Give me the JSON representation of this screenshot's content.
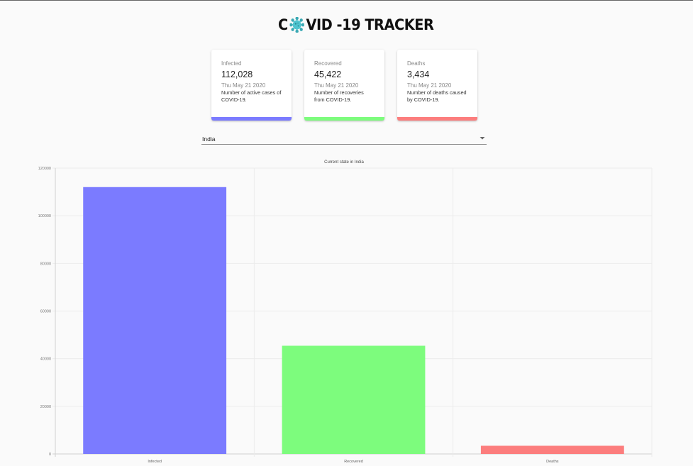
{
  "header": {
    "logo_prefix": "C",
    "logo_suffix": "VID -19 TRACKER"
  },
  "cards": [
    {
      "label": "Infected",
      "count": "112,028",
      "date": "Thu May 21 2020",
      "description": "Number of active cases of COVID-19.",
      "color": "#7b7bff"
    },
    {
      "label": "Recovered",
      "count": "45,422",
      "date": "Thu May 21 2020",
      "description": "Number of recoveries from COVID-19.",
      "color": "#7dfc7d"
    },
    {
      "label": "Deaths",
      "count": "3,434",
      "date": "Thu May 21 2020",
      "description": "Number of deaths caused by COVID-19.",
      "color": "#fc7d7d"
    }
  ],
  "country_select": {
    "value": "India"
  },
  "chart_data": {
    "type": "bar",
    "title": "Current state in India",
    "categories": [
      "Infected",
      "Recovered",
      "Deaths"
    ],
    "values": [
      112028,
      45422,
      3434
    ],
    "colors": [
      "#7b7bff",
      "#7dfc7d",
      "#fc7d7d"
    ],
    "ylim": [
      0,
      120000
    ],
    "yticks": [
      "0",
      "20000",
      "40000",
      "60000",
      "80000",
      "100000",
      "120000"
    ],
    "grid": true,
    "xlabel": "",
    "ylabel": ""
  }
}
